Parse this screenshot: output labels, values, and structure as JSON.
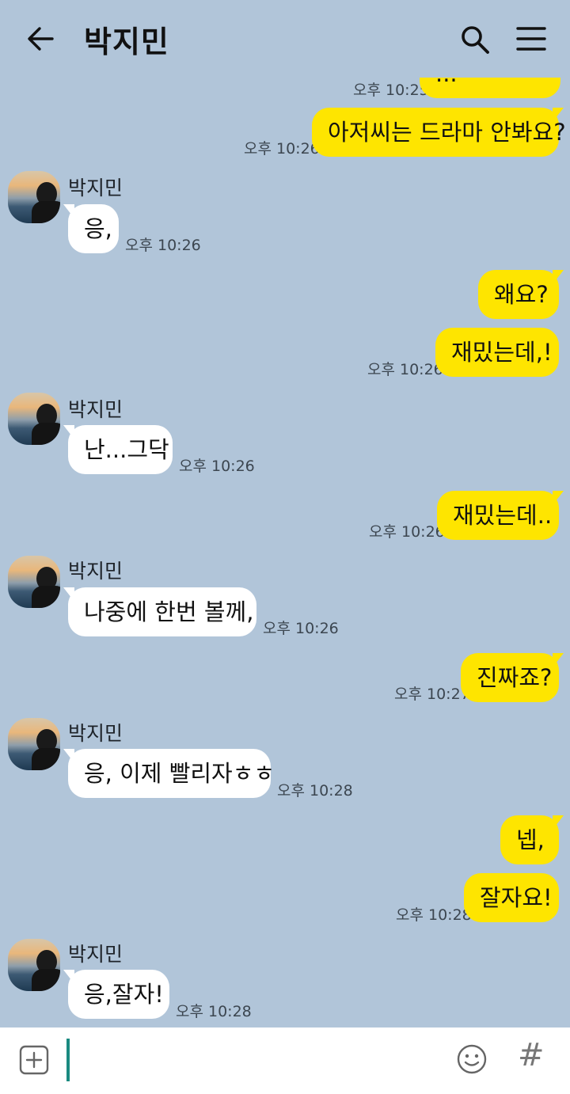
{
  "header": {
    "title": "박지민"
  },
  "messages": [
    {
      "from": "me",
      "text": "...",
      "time": "오후 10:25"
    },
    {
      "from": "me",
      "text": "아저씨는 드라마 안봐요?",
      "time": "오후 10:26"
    },
    {
      "from": "them",
      "name": "박지민",
      "text": "응,",
      "time": "오후 10:26"
    },
    {
      "from": "me",
      "text": "왜요?",
      "time": ""
    },
    {
      "from": "me",
      "text": "재밌는데,!",
      "time": "오후 10:26"
    },
    {
      "from": "them",
      "name": "박지민",
      "text": "난...그닥",
      "time": "오후 10:26"
    },
    {
      "from": "me",
      "text": "재밌는데..",
      "time": "오후 10:26"
    },
    {
      "from": "them",
      "name": "박지민",
      "text": "나중에 한번 볼께,",
      "time": "오후 10:26"
    },
    {
      "from": "me",
      "text": "진짜죠?",
      "time": "오후 10:27"
    },
    {
      "from": "them",
      "name": "박지민",
      "text": "응, 이제 빨리자ㅎㅎ",
      "time": "오후 10:28"
    },
    {
      "from": "me",
      "text": "넵,",
      "time": ""
    },
    {
      "from": "me",
      "text": "잘자요!",
      "time": "오후 10:28"
    },
    {
      "from": "them",
      "name": "박지민",
      "text": "응,잘자!",
      "time": "오후 10:28"
    }
  ],
  "input": {
    "value": "",
    "placeholder": ""
  },
  "colors": {
    "background": "#b1c5d9",
    "my_bubble": "#fee500",
    "their_bubble": "#ffffff",
    "caret": "#1a8a80"
  },
  "icons": {
    "back": "back-arrow-icon",
    "search": "search-icon",
    "menu": "menu-icon",
    "attach": "plus-icon",
    "emoji": "emoji-icon",
    "hashtag": "hashtag-icon"
  }
}
